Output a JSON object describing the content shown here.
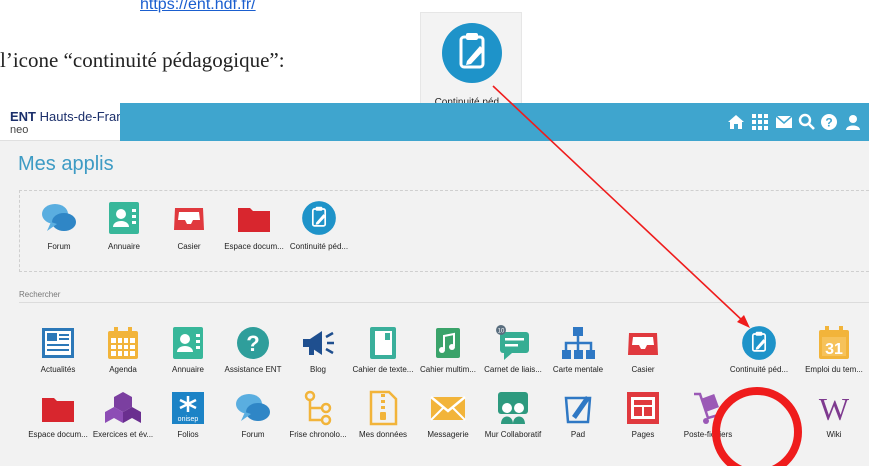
{
  "doc": {
    "link_text": "https://ent.hdf.fr/",
    "instruction": "l’icone “continuité pédagogique”:",
    "zoom_label": "Continuité péd..."
  },
  "header": {
    "logo_brand": "ENT",
    "logo_region": "Hauts-de-France",
    "logo_sub": "neo",
    "icons": [
      "home-icon",
      "apps-grid-icon",
      "mail-icon",
      "search-icon",
      "help-icon",
      "user-icon"
    ],
    "color": "#3fa5ce"
  },
  "page": {
    "title": "Mes applis",
    "search_label": "Rechercher"
  },
  "my_apps": [
    {
      "label": "Forum"
    },
    {
      "label": "Annuaire"
    },
    {
      "label": "Casier"
    },
    {
      "label": "Espace docum..."
    },
    {
      "label": "Continuité péd..."
    }
  ],
  "all_apps": [
    {
      "label": "Actualités"
    },
    {
      "label": "Agenda"
    },
    {
      "label": "Annuaire"
    },
    {
      "label": "Assistance ENT"
    },
    {
      "label": "Blog"
    },
    {
      "label": "Cahier de texte..."
    },
    {
      "label": "Cahier multim..."
    },
    {
      "label": "Carnet de liais..."
    },
    {
      "label": "Carte mentale"
    },
    {
      "label": "Casier"
    },
    {
      "label": "Continuité péd..."
    },
    {
      "label": "Emploi du tem..."
    },
    {
      "label": "Espace docum..."
    },
    {
      "label": "Exercices et év..."
    },
    {
      "label": "Folios"
    },
    {
      "label": "Forum"
    },
    {
      "label": "Frise chronolo..."
    },
    {
      "label": "Mes données"
    },
    {
      "label": "Messagerie"
    },
    {
      "label": "Mur Collaboratif"
    },
    {
      "label": "Pad"
    },
    {
      "label": "Pages"
    },
    {
      "label": "Poste-fichiers"
    },
    {
      "label": "Wiki"
    }
  ],
  "icon_texts": {
    "calendar_day": "31",
    "onisep": "onisep",
    "wiki": "W",
    "carnet_badge": "10"
  },
  "annotation": {
    "highlight_color": "#ef1c1c"
  }
}
